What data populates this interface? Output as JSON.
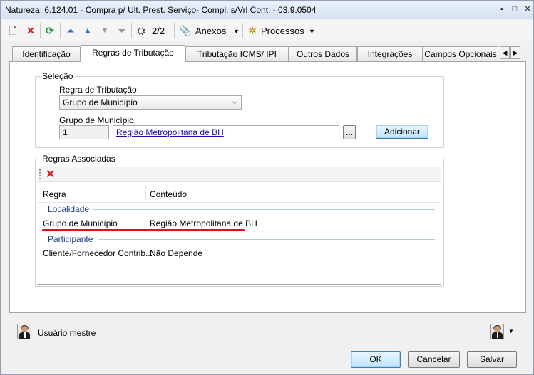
{
  "window": {
    "title": "Natureza: 6.124.01 - Compra p/ Ult. Prest. Serviço- Compl. s/Vrl Cont. - 03.9.0504"
  },
  "titlebar_buttons": {
    "minimize": "▪",
    "maximize": "□",
    "close": "✕"
  },
  "toolbar": {
    "new_icon": "🗋",
    "delete_icon": "✕",
    "refresh_icon": "⟳",
    "first_icon": "⏶",
    "prev_icon": "▲",
    "next_icon": "▼",
    "last_icon": "⏷",
    "binoculars_icon": "⛭",
    "page_counter": "2/2",
    "attach_icon": "📎",
    "attachments_label": "Anexos",
    "processes_icon": "✲",
    "processes_label": "Processos",
    "dropdown_arrow": "▼"
  },
  "tabs": [
    {
      "label": "Identificação",
      "active": false
    },
    {
      "label": "Regras de Tributação",
      "active": true
    },
    {
      "label": "Tributação ICMS/ IPI",
      "active": false
    },
    {
      "label": "Outros Dados",
      "active": false
    },
    {
      "label": "Integrações",
      "active": false
    },
    {
      "label": "Campos Opcionais",
      "active": false
    }
  ],
  "tab_scroll": {
    "left": "◀",
    "right": "▶"
  },
  "selection": {
    "legend": "Seleção",
    "rule_label": "Regra de Tributação:",
    "rule_value": "Grupo de Município",
    "rule_arrow": "⌵",
    "group_label": "Grupo de Município:",
    "group_code": "1",
    "group_name": "Região Metropolitana de BH",
    "browse_label": "...",
    "add_label": "Adicionar"
  },
  "associated": {
    "legend": "Regras Associadas",
    "delete_icon": "✕",
    "columns": [
      "Regra",
      "Conteúdo"
    ],
    "groups": [
      {
        "title": "Localidade",
        "rows": [
          {
            "rule": "Grupo de Município",
            "content": "Região Metropolitana de BH"
          }
        ]
      },
      {
        "title": "Participante",
        "rows": [
          {
            "rule": "Cliente/Fornecedor Contrib...",
            "content": "Não Depende"
          }
        ]
      }
    ]
  },
  "footer": {
    "user_label": "Usuário mestre",
    "ok_label": "OK",
    "cancel_label": "Cancelar",
    "save_label": "Salvar"
  },
  "colors": {
    "highlight_underline": "#e0101a",
    "link": "#1a0dab",
    "group_title": "#1e3f88"
  }
}
